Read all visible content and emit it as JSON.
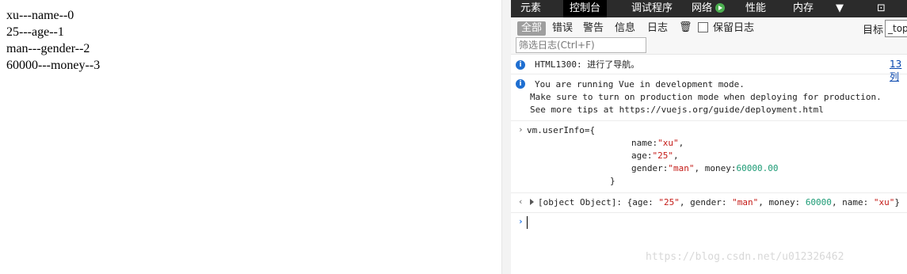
{
  "page": {
    "lines": [
      "xu---name--0",
      "25---age--1",
      "man---gender--2",
      "60000---money--3"
    ]
  },
  "devtools": {
    "tabs": [
      "元素",
      "控制台",
      "调试程序",
      "网络",
      "性能",
      "内存"
    ],
    "active_tab": "控制台",
    "filters": [
      "全部",
      "错误",
      "警告",
      "信息",
      "日志"
    ],
    "active_filter": "全部",
    "preserve_log_label": "保留日志",
    "target_label": "目标",
    "target_value": "_top",
    "filter_placeholder": "筛选日志(Ctrl+F)"
  },
  "console": {
    "msg1": {
      "text": "HTML1300: 进行了导航。",
      "link": "13列"
    },
    "msg2": {
      "line1": "You are running Vue in development mode.",
      "line2": "Make sure to turn on production mode when deploying for production.",
      "line3": "See more tips at https://vuejs.org/guide/deployment.html"
    },
    "input": {
      "line1": "vm.userInfo={",
      "l2_key": "name:",
      "l2_val": "\"xu\"",
      "l2_end": ",",
      "l3_key": "age:",
      "l3_val": "\"25\"",
      "l3_end": ",",
      "l4_key": "gender:",
      "l4_val": "\"man\"",
      "l4_mid": ", money:",
      "l4_num": "60000.00",
      "l5": "}"
    },
    "result": {
      "prefix": "[object Object]: ",
      "brace_open": "{age: ",
      "age": "\"25\"",
      "sep1": ", gender: ",
      "gender": "\"man\"",
      "sep2": ", money: ",
      "money": "60000",
      "sep3": ", name: ",
      "name": "\"xu\"",
      "brace_close": "}"
    }
  },
  "watermark": "https://blog.csdn.net/u012326462",
  "colors": {
    "string": "#c41a16",
    "number": "#1c9b75",
    "info": "#1f6fd1",
    "tabbar": "#2b2b2b"
  }
}
